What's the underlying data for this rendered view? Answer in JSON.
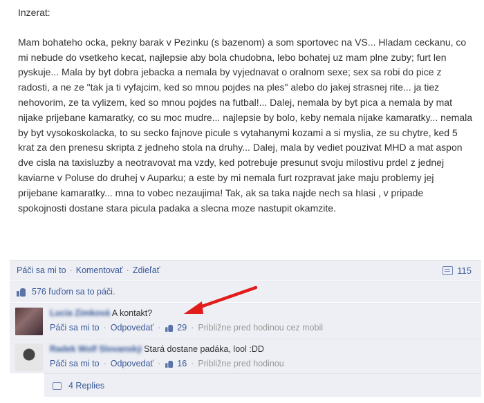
{
  "post": {
    "heading": "Inzerat:",
    "body": "Mam bohateho ocka, pekny barak v Pezinku (s bazenom) a som sportovec na VS... Hladam ceckanu, co mi nebude do vsetkeho kecat, najlepsie aby bola chudobna, lebo bohatej uz mam plne zuby; furt len pyskuje... Mala by byt dobra jebacka a nemala by vyjednavat o oralnom sexe; sex sa robi do pice z radosti, a ne ze \"tak ja ti vyfajcim, ked so mnou pojdes na ples\" alebo do jakej strasnej rite... ja tiez nehovorim, ze ta vylizem, ked so mnou pojdes na futbal!... Dalej, nemala by byt pica a nemala by mat nijake prijebane kamaratky, co su moc mudre... najlepsie by bolo, keby nemala nijake kamaratky... nemala by byt vysokoskolacka, to su secko fajnove picule s vytahanymi kozami a si myslia, ze su chytre, ked 5 krat za den prenesu skripta z jedneho stola na druhy... Dalej, mala by vediet pouzivat MHD a mat aspon dve cisla na taxisluzby a neotravovat ma vzdy, ked potrebuje presunut svoju milostivu prdel z jednej kaviarne v Poluse do druhej v Auparku; a este by mi nemala furt rozpravat jake maju problemy jej prijebane kamaratky... mna to vobec nezaujima! Tak, ak sa taka najde nech sa hlasi , v pripade spokojnosti dostane stara picula padaka a slecna moze nastupit okamzite."
  },
  "actions": {
    "like": "Páči sa mi to",
    "comment": "Komentovať",
    "share": "Zdieľať",
    "sep": "·",
    "comment_count": "115"
  },
  "likes": {
    "text": "576 ľuďom sa to páči."
  },
  "comments": [
    {
      "author": "Lucia Zimková",
      "text": "A kontakt?",
      "like": "Páči sa mi to",
      "reply": "Odpovedať",
      "like_count": "29",
      "time": "Približne pred hodinou cez mobil"
    },
    {
      "author": "Radek Wolf Slovanský",
      "text": "Stará dostane padáka, lool :DD",
      "like": "Páči sa mi to",
      "reply": "Odpovedať",
      "like_count": "16",
      "time": "Približne pred hodinou"
    }
  ],
  "replies": {
    "label": "4 Replies"
  },
  "colors": {
    "link": "#3b5998",
    "panel": "#edeff4",
    "arrow": "#e21b1b"
  }
}
